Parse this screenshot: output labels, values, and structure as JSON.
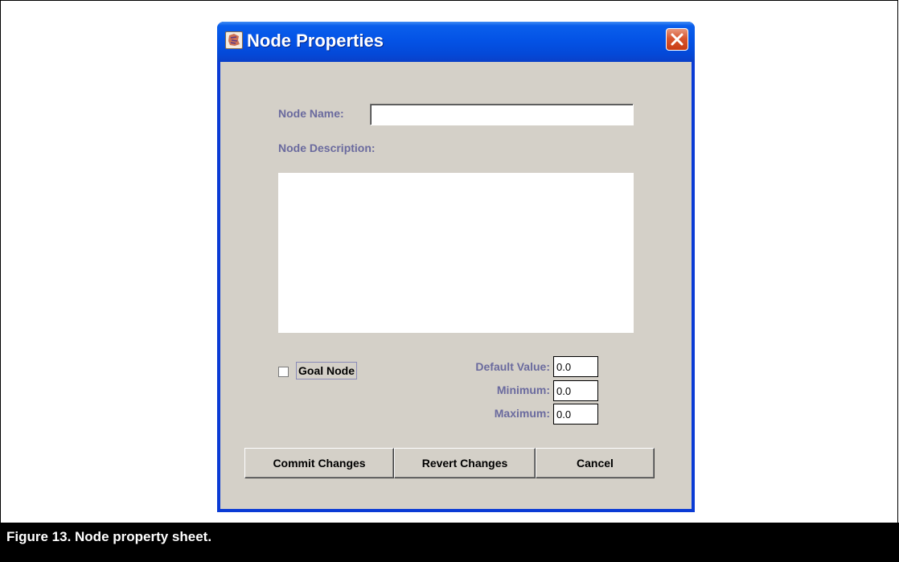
{
  "window": {
    "title": "Node Properties"
  },
  "form": {
    "node_name_label": "Node Name:",
    "node_name_value": "",
    "node_description_label": "Node Description:",
    "node_description_value": "",
    "goal_node_label": "Goal Node",
    "goal_node_checked": false,
    "default_value_label": "Default Value:",
    "default_value": "0.0",
    "minimum_label": "Minimum:",
    "minimum_value": "0.0",
    "maximum_label": "Maximum:",
    "maximum_value": "0.0"
  },
  "buttons": {
    "commit": "Commit Changes",
    "revert": "Revert Changes",
    "cancel": "Cancel"
  },
  "caption": "Figure 13.  Node property sheet.",
  "colors": {
    "titlebar": "#0453e6",
    "client_bg": "#d4d0c8",
    "label_text": "#6a6a9e",
    "close_button": "#d8562f"
  },
  "icons": {
    "app": "app-icon",
    "close": "close-icon"
  }
}
